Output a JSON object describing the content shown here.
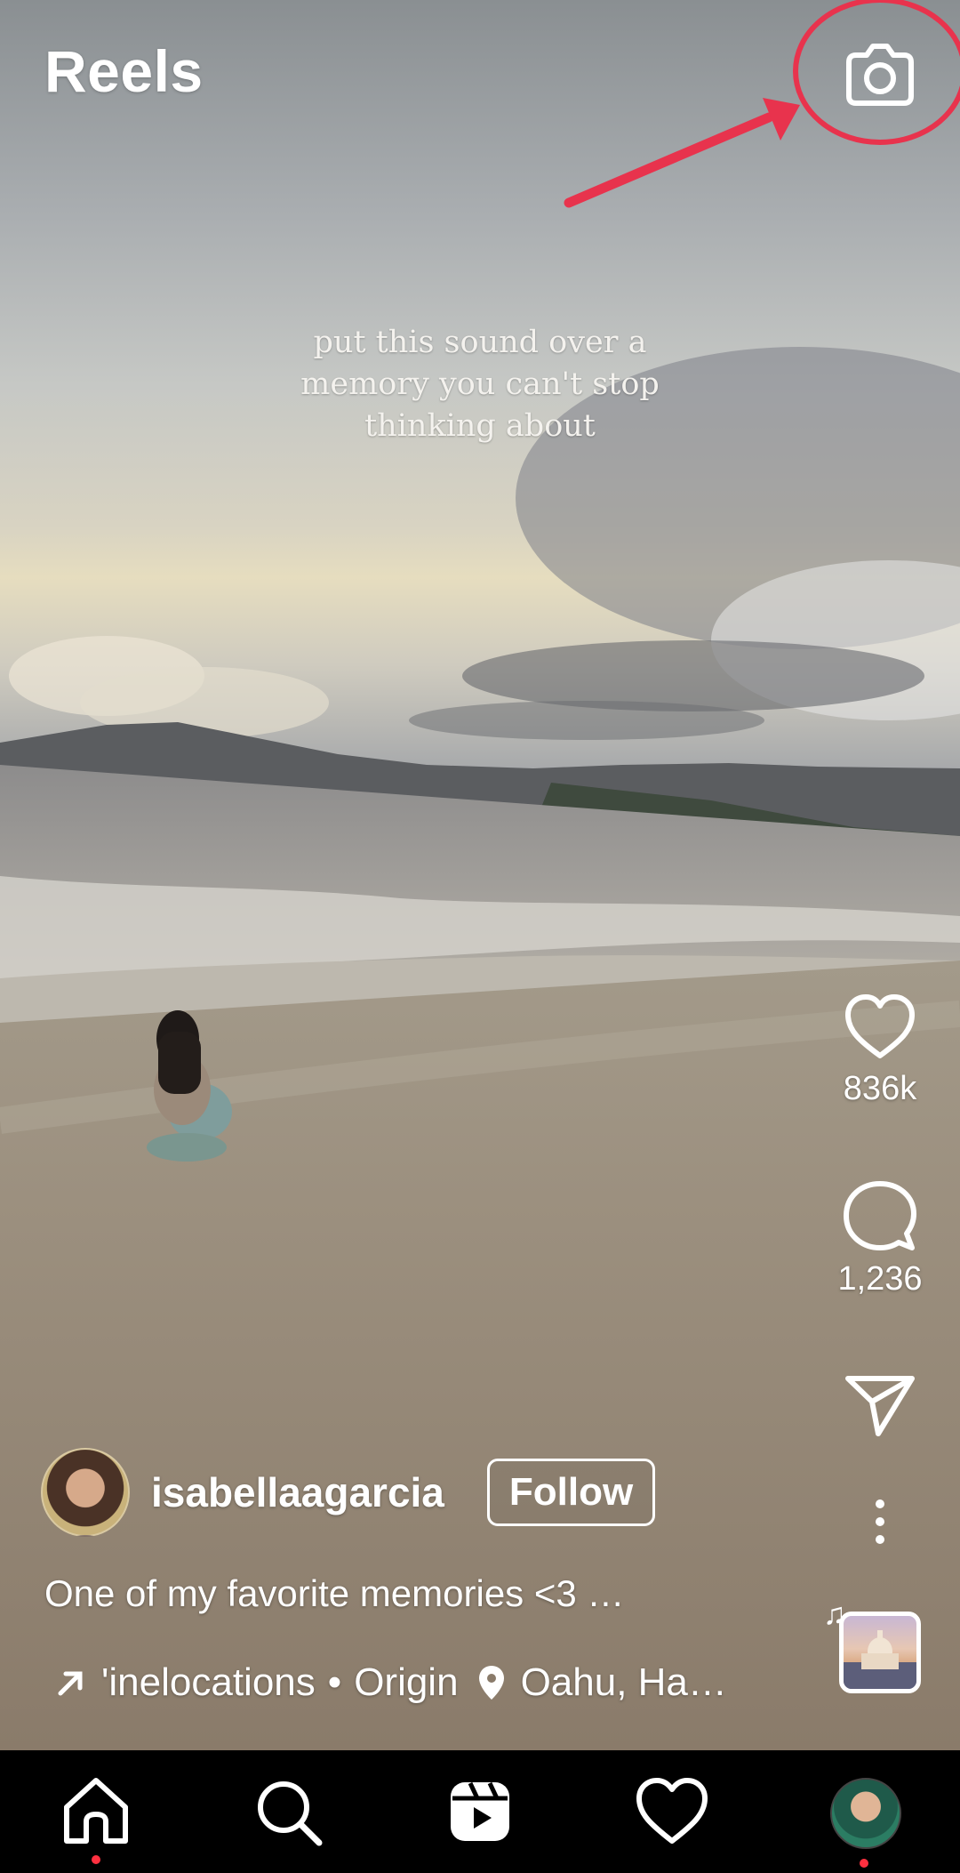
{
  "header": {
    "title": "Reels"
  },
  "overlay": {
    "lines": [
      "put this sound over a",
      "memory you can't stop",
      "thinking about"
    ]
  },
  "actions": {
    "likes": "836k",
    "comments": "1,236"
  },
  "author": {
    "username": "isabellaagarcia",
    "follow_label": "Follow"
  },
  "caption": "One of my favorite memories <3 …",
  "meta": {
    "audio_text": "'inelocations",
    "separator": "•",
    "audio_title": "Origin",
    "location": "Oahu, Ha…"
  },
  "colors": {
    "annotation": "#e8334d",
    "notification_dot": "#ff3040"
  },
  "icons": [
    "camera-icon",
    "heart-icon",
    "comment-icon",
    "share-icon",
    "more-icon",
    "arrow-icon",
    "location-pin-icon",
    "music-note-icon",
    "home-icon",
    "search-icon",
    "reels-icon",
    "activity-heart-icon",
    "profile-avatar"
  ]
}
